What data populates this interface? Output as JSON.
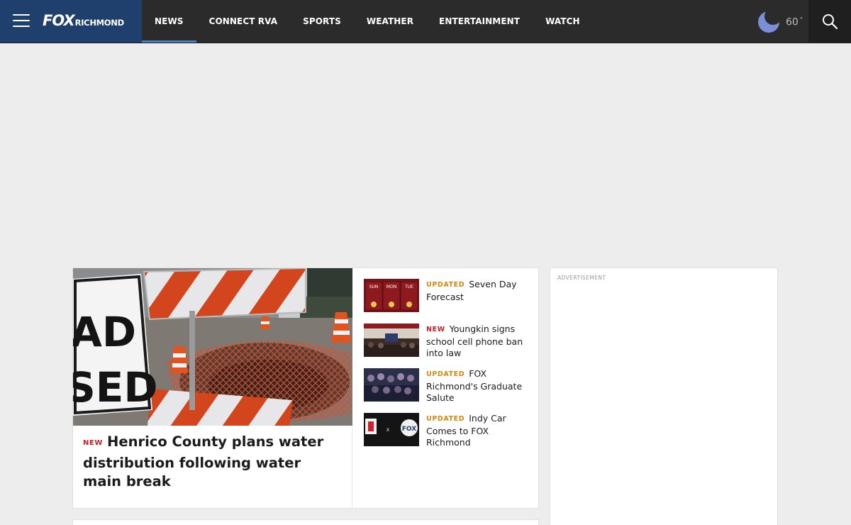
{
  "header": {
    "logo_main": "FOX",
    "logo_city": "RICHMOND",
    "nav": [
      {
        "label": "NEWS",
        "active": true
      },
      {
        "label": "CONNECT RVA",
        "active": false
      },
      {
        "label": "SPORTS",
        "active": false
      },
      {
        "label": "WEATHER",
        "active": false
      },
      {
        "label": "ENTERTAINMENT",
        "active": false
      },
      {
        "label": "WATCH",
        "active": false
      }
    ],
    "weather": {
      "icon": "moon-icon",
      "temperature": "60",
      "degree": "°"
    }
  },
  "hero": {
    "tag": "NEW",
    "title": "Henrico County plans water distribution following water main break",
    "image": "road-closed-water-main-break-photo"
  },
  "stories": [
    {
      "tag": "UPDATED",
      "title": "Seven Day Forecast",
      "thumb": "forecast-thumb",
      "thumb_text": [
        "SUN",
        "MON",
        "TUE"
      ]
    },
    {
      "tag": "NEW",
      "title": "Youngkin signs school cell phone ban into law",
      "thumb": "bill-signing-thumb"
    },
    {
      "tag": "UPDATED",
      "title": "FOX Richmond's Graduate Salute",
      "thumb": "graduates-thumb"
    },
    {
      "tag": "UPDATED",
      "title": "Indy Car Comes to FOX Richmond",
      "thumb": "indycar-fox-thumb",
      "thumb_text": [
        "x",
        "FOX"
      ]
    }
  ],
  "ad": {
    "label": "ADVERTISEMENT"
  },
  "colors": {
    "header_bg": "#2b2b2b",
    "brand_bg": "#1f3f6c",
    "active_underline": "#4b7fc2",
    "tag_new": "#c0202a",
    "tag_updated": "#cf8a12",
    "page_bg": "#ededed"
  }
}
